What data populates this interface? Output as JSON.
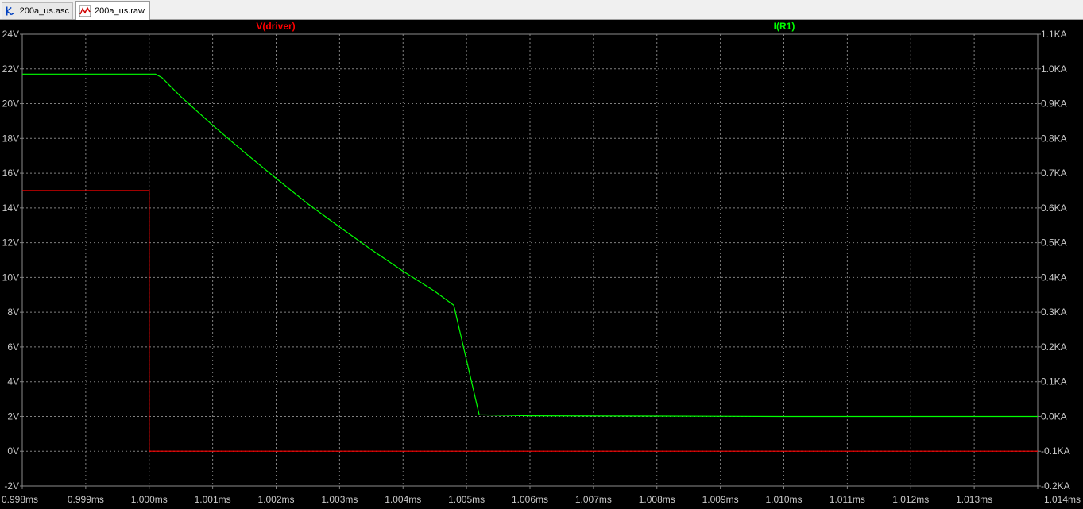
{
  "tabs": [
    {
      "label": "200a_us.asc",
      "icon": "schematic-icon",
      "active": false
    },
    {
      "label": "200a_us.raw",
      "icon": "waveform-icon",
      "active": true
    }
  ],
  "colors": {
    "background": "#000000",
    "grid": "#808080",
    "axis_text": "#c8c8c8",
    "v_driver": "#ff0000",
    "i_r1": "#00ff00"
  },
  "chart_data": {
    "type": "line",
    "xlabel": "",
    "ylabel": "",
    "grid": true,
    "xlim": [
      0.998,
      1.014
    ],
    "x_ticks": [
      0.998,
      0.999,
      1.0,
      1.001,
      1.002,
      1.003,
      1.004,
      1.005,
      1.006,
      1.007,
      1.008,
      1.009,
      1.01,
      1.011,
      1.012,
      1.013,
      1.014
    ],
    "x_tick_labels": [
      "0.998ms",
      "0.999ms",
      "1.000ms",
      "1.001ms",
      "1.002ms",
      "1.003ms",
      "1.004ms",
      "1.005ms",
      "1.006ms",
      "1.007ms",
      "1.008ms",
      "1.009ms",
      "1.010ms",
      "1.011ms",
      "1.012ms",
      "1.013ms",
      "1.014ms"
    ],
    "ylim_left": [
      -2,
      24
    ],
    "left_ticks": [
      -2,
      0,
      2,
      4,
      6,
      8,
      10,
      12,
      14,
      16,
      18,
      20,
      22,
      24
    ],
    "left_tick_labels": [
      "-2V",
      "0V",
      "2V",
      "4V",
      "6V",
      "8V",
      "10V",
      "12V",
      "14V",
      "16V",
      "18V",
      "20V",
      "22V",
      "24V"
    ],
    "ylim_right": [
      -0.2,
      1.1
    ],
    "right_ticks": [
      -0.2,
      -0.1,
      0.0,
      0.1,
      0.2,
      0.3,
      0.4,
      0.5,
      0.6,
      0.7,
      0.8,
      0.9,
      1.0,
      1.1
    ],
    "right_tick_labels": [
      "-0.2KA",
      "-0.1KA",
      "0.0KA",
      "0.1KA",
      "0.2KA",
      "0.3KA",
      "0.4KA",
      "0.5KA",
      "0.6KA",
      "0.7KA",
      "0.8KA",
      "0.9KA",
      "1.0KA",
      "1.1KA"
    ],
    "series": [
      {
        "name": "V(driver)",
        "axis": "left",
        "color": "#ff0000",
        "x": [
          0.998,
          1.0,
          1.0,
          1.014
        ],
        "y": [
          15,
          15,
          0,
          0
        ]
      },
      {
        "name": "I(R1)",
        "axis": "right",
        "color": "#00ff00",
        "x": [
          0.998,
          1.0001,
          1.0002,
          1.0005,
          1.001,
          1.0015,
          1.002,
          1.0025,
          1.003,
          1.0035,
          1.004,
          1.0045,
          1.0048,
          1.0052,
          1.006,
          1.008,
          1.01,
          1.012,
          1.014
        ],
        "y": [
          0.985,
          0.985,
          0.975,
          0.92,
          0.838,
          0.76,
          0.685,
          0.612,
          0.545,
          0.48,
          0.418,
          0.36,
          0.32,
          0.005,
          0.002,
          0.001,
          0.0,
          0.0,
          0.0
        ]
      }
    ]
  }
}
